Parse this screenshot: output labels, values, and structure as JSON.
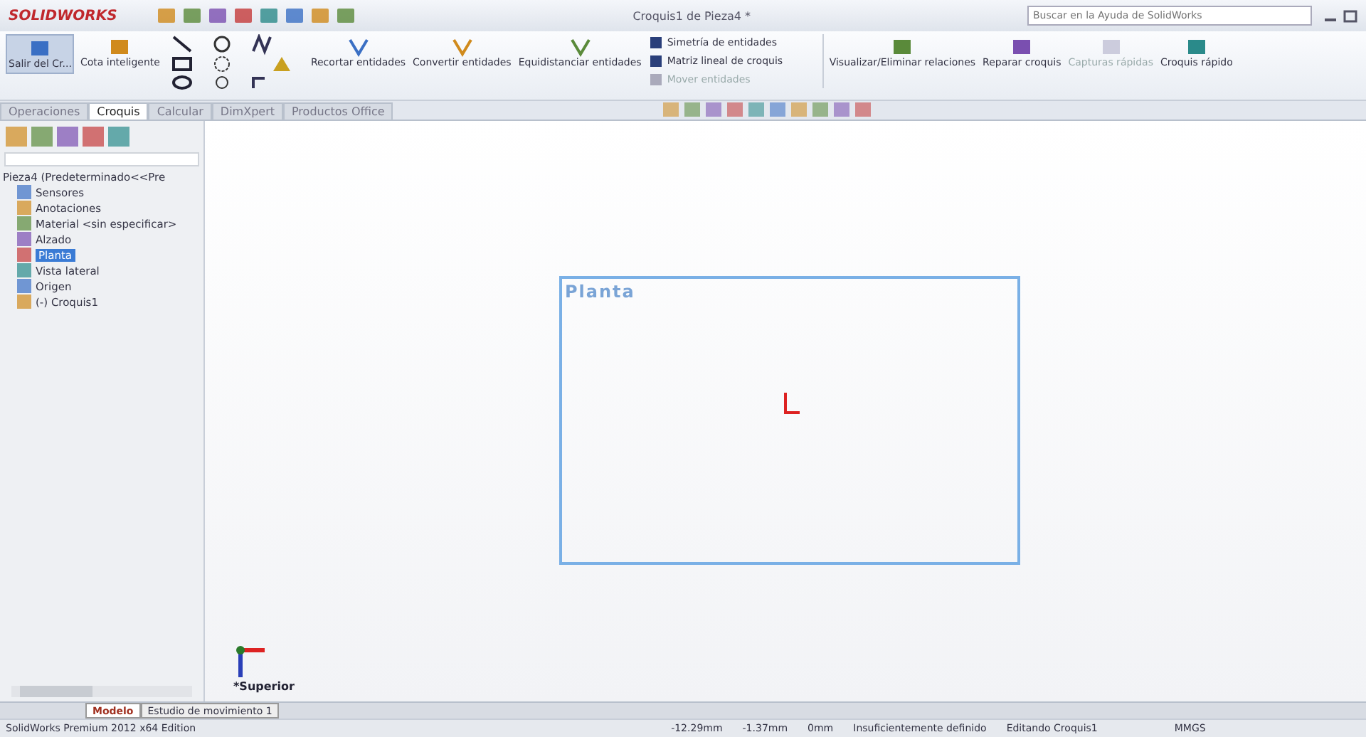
{
  "app": {
    "logo": "SOLIDWORKS",
    "title": "Croquis1 de Pieza4 *",
    "search": {
      "placeholder": "Buscar en la Ayuda de SolidWorks"
    }
  },
  "ribbon": {
    "large_left": [
      {
        "label": "Salir del Cr...",
        "selected": true
      },
      {
        "label": "Cota inteligente",
        "selected": false
      }
    ],
    "large_mid": [
      {
        "label": "Recortar entidades"
      },
      {
        "label": "Convertir entidades"
      },
      {
        "label": "Equidistanciar entidades"
      }
    ],
    "list": [
      {
        "label": "Simetría de entidades",
        "disabled": false
      },
      {
        "label": "Matriz lineal de croquis",
        "disabled": false
      },
      {
        "label": "Mover entidades",
        "disabled": true
      }
    ],
    "large_right": [
      {
        "label": "Visualizar/Eliminar relaciones",
        "disabled": false
      },
      {
        "label": "Reparar croquis",
        "disabled": false
      },
      {
        "label": "Capturas rápidas",
        "disabled": true
      },
      {
        "label": "Croquis rápido",
        "disabled": false
      }
    ]
  },
  "tabs": [
    {
      "label": "Operaciones",
      "selected": false
    },
    {
      "label": "Croquis",
      "selected": true
    },
    {
      "label": "Calcular",
      "selected": false
    },
    {
      "label": "DimXpert",
      "selected": false
    },
    {
      "label": "Productos Office",
      "selected": false
    }
  ],
  "tree": {
    "root": "Pieza4 (Predeterminado<<Pre",
    "items": [
      {
        "label": "Sensores",
        "selected": false
      },
      {
        "label": "Anotaciones",
        "selected": false
      },
      {
        "label": "Material <sin especificar>",
        "selected": false
      },
      {
        "label": "Alzado",
        "selected": false
      },
      {
        "label": "Planta",
        "selected": true
      },
      {
        "label": "Vista lateral",
        "selected": false
      },
      {
        "label": "Origen",
        "selected": false
      },
      {
        "label": "(-) Croquis1",
        "selected": false
      }
    ]
  },
  "canvas": {
    "plane_label": "Planta",
    "view_label": "*Superior"
  },
  "bottom_tabs": [
    {
      "label": "Modelo",
      "selected": true
    },
    {
      "label": "Estudio de movimiento 1",
      "selected": false
    }
  ],
  "status_bar": {
    "product": "SolidWorks Premium 2012 x64 Edition",
    "x": "-12.29mm",
    "y": "-1.37mm",
    "z": "0mm",
    "state": "Insuficientemente definido",
    "mode": "Editando Croquis1",
    "units": "MMGS"
  }
}
